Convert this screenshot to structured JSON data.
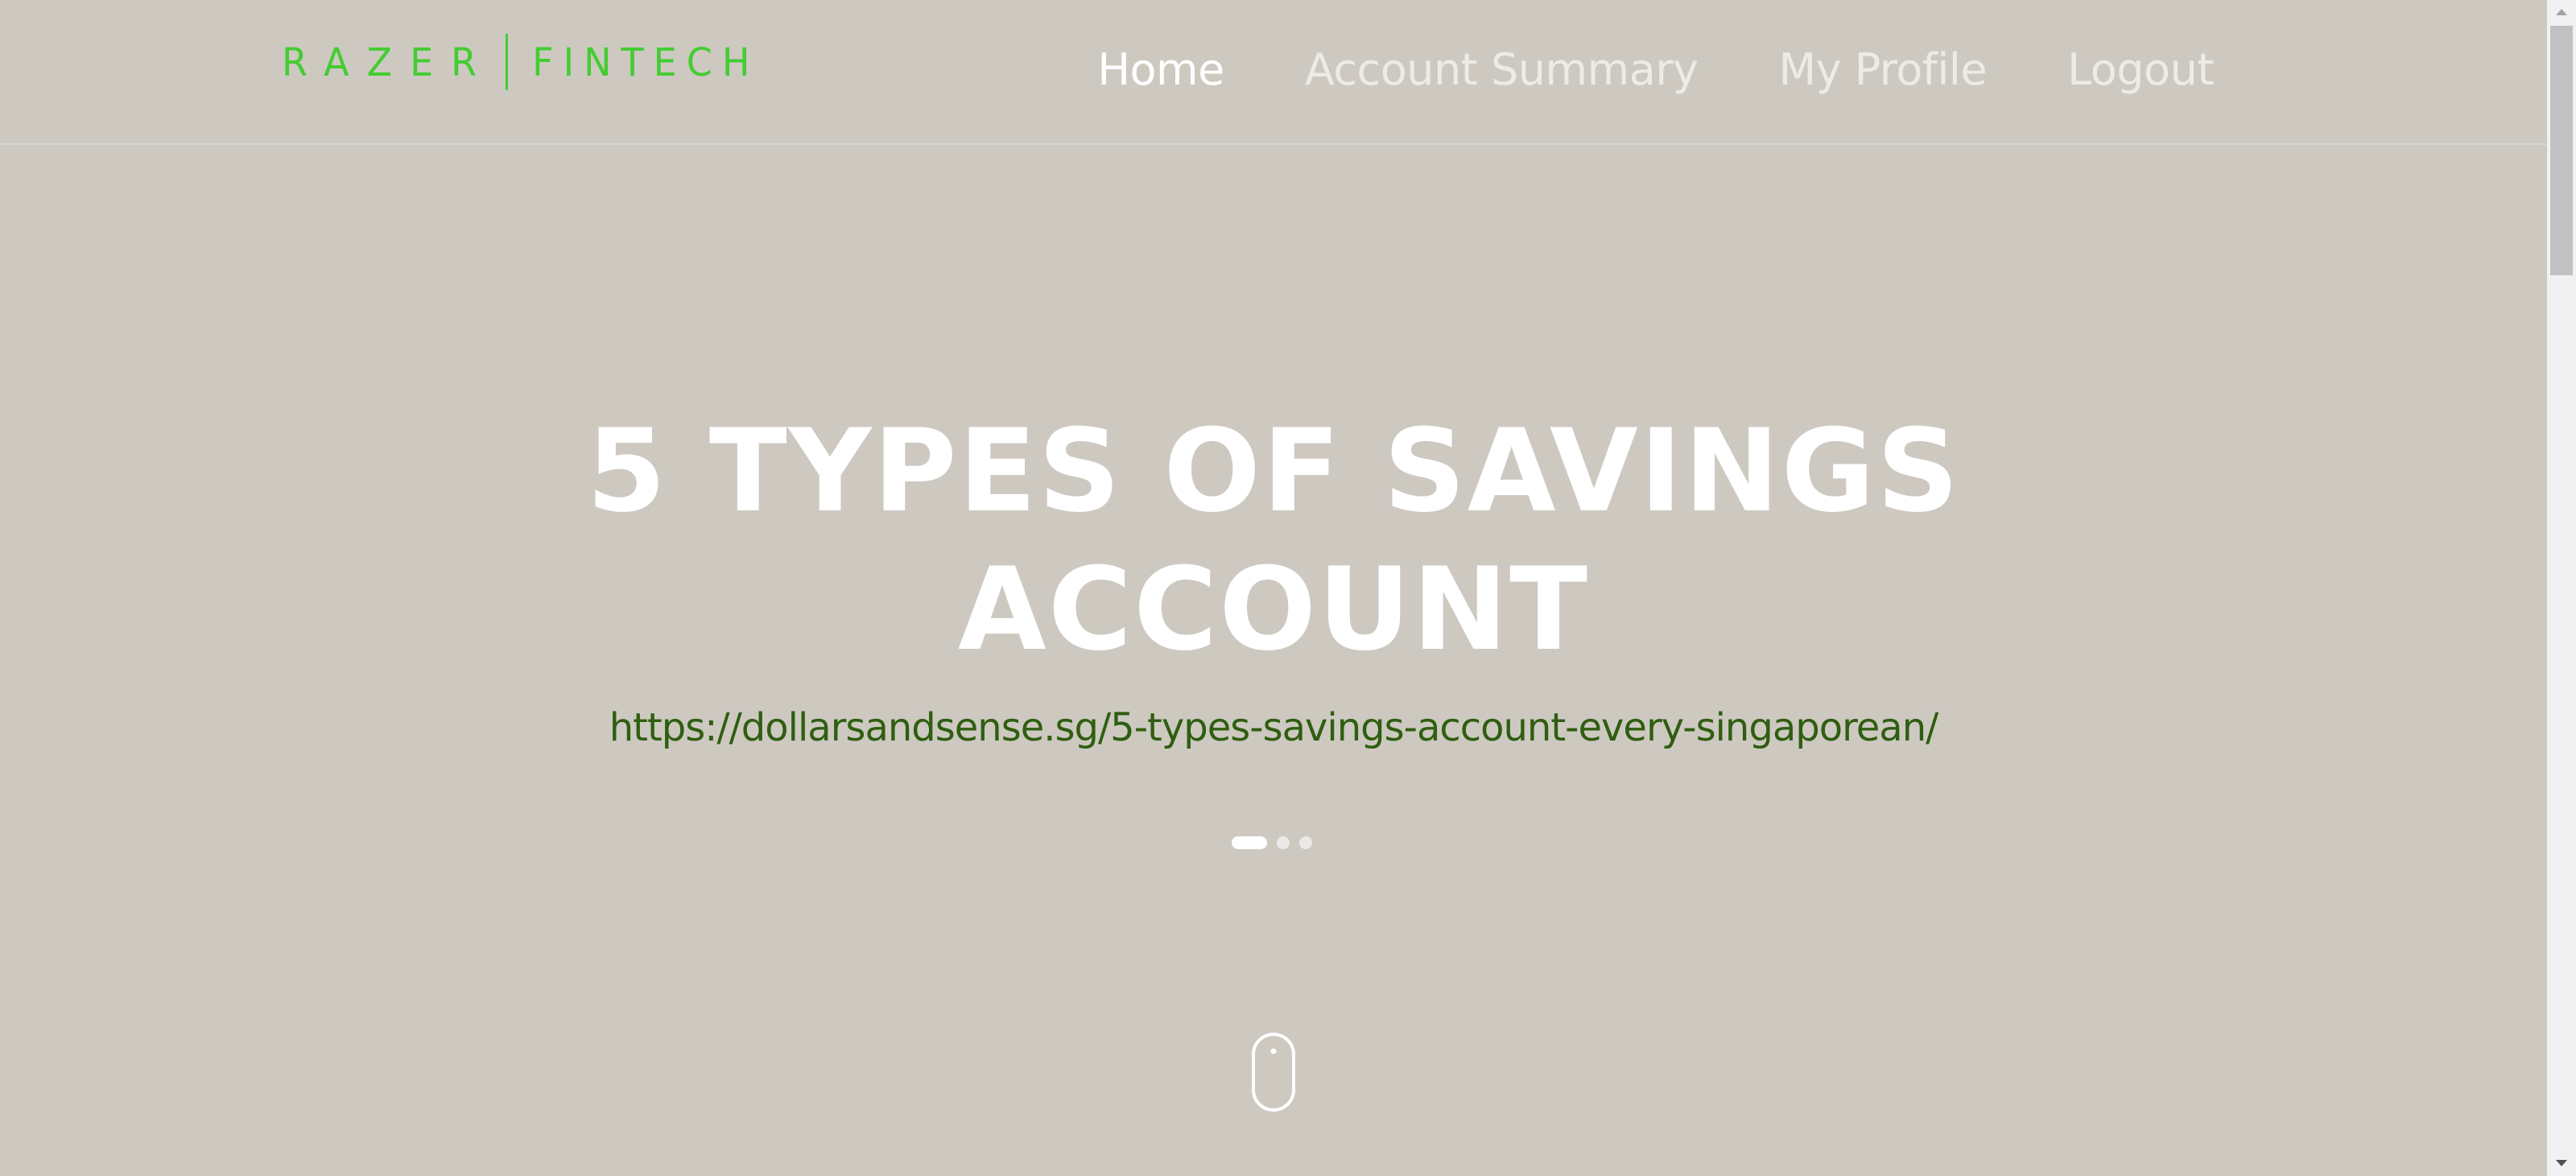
{
  "navbar": {
    "logo": {
      "brand": "RAZER",
      "product": "FINTECH"
    },
    "links": [
      {
        "label": "Home",
        "active": true
      },
      {
        "label": "Account Summary",
        "active": false
      },
      {
        "label": "My Profile",
        "active": false
      },
      {
        "label": "Logout",
        "active": false
      }
    ]
  },
  "hero": {
    "title_line1": "5 TYPES OF SAVINGS",
    "title_line2": "ACCOUNT",
    "link": "https://dollarsandsense.sg/5-types-savings-account-every-singaporean/",
    "carousel": {
      "slide_count": 3,
      "active_index": 0
    },
    "scroll_icon": "mouse-scroll-icon"
  },
  "colors": {
    "background": "#cdc9c1",
    "logo_green": "#44cc33",
    "link_green": "#2f5e10",
    "title_white": "#ffffff"
  }
}
